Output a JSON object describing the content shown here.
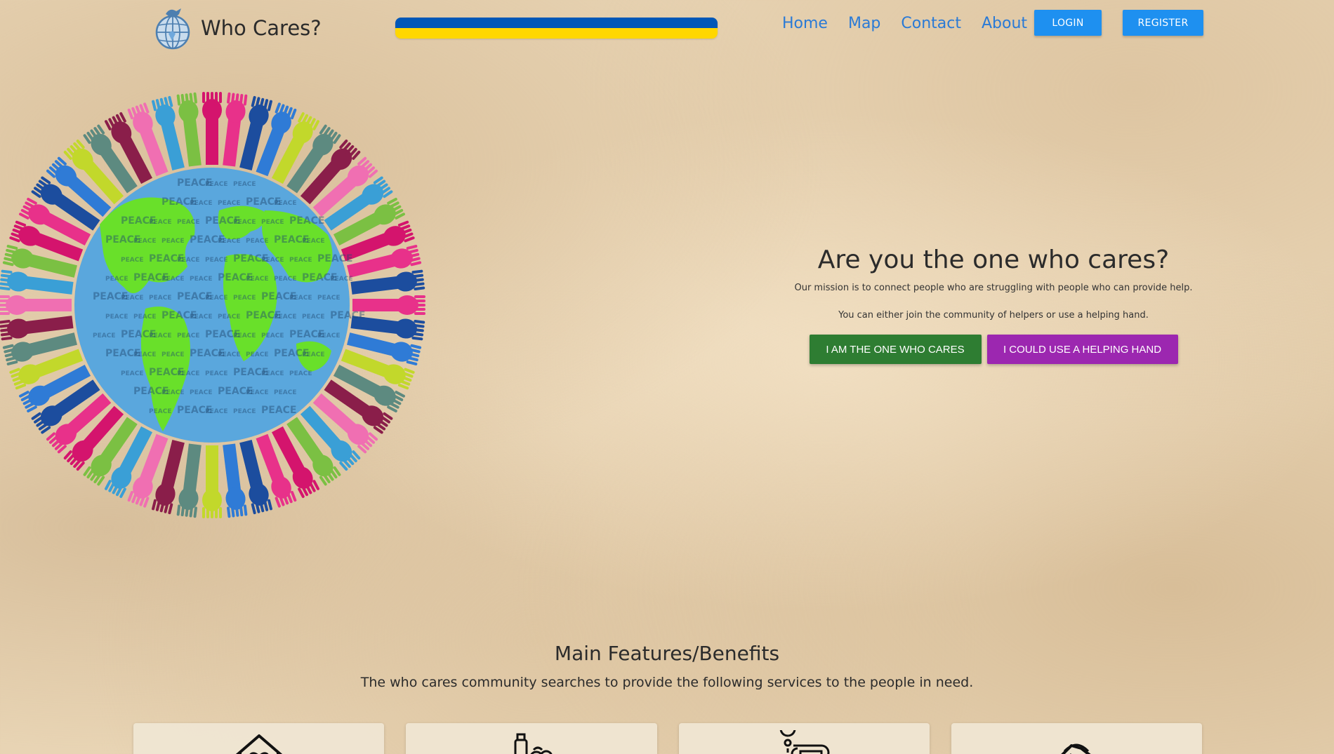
{
  "header": {
    "brand_name": "Who Cares?",
    "flag_colors": [
      "#0057b7",
      "#ffd700"
    ],
    "nav": [
      "Home",
      "Map",
      "Contact",
      "About"
    ],
    "login_label": "LOGIN",
    "register_label": "REGISTER"
  },
  "hero": {
    "image_icon": "peace-globe-hands",
    "title": "Are you the one who cares?",
    "mission": "Our mission is to connect people who are struggling with people who can provide help.",
    "join": "You can either join the community of helpers or use a helping hand.",
    "cta_helper": "I AM THE ONE WHO CARES",
    "cta_help": "I COULD USE A HELPING HAND",
    "globe_word": "PEACE"
  },
  "features": {
    "title": "Main Features/Benefits",
    "subtitle": "The who cares community searches to provide the following services to the people in need.",
    "cards": [
      {
        "icon": "home-heart-icon"
      },
      {
        "icon": "food-groceries-icon"
      },
      {
        "icon": "transport-location-icon"
      },
      {
        "icon": "handshake-icon"
      }
    ]
  },
  "colors": {
    "link": "#2a7ad6",
    "primary_button": "#1e90f0",
    "green_button": "#2e7d32",
    "purple_button": "#9c27b0"
  }
}
